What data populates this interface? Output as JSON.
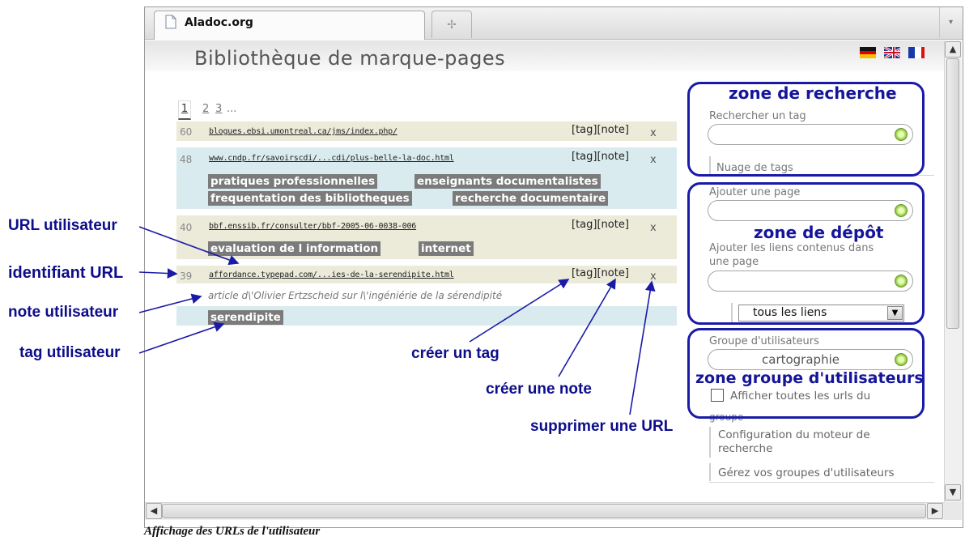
{
  "browser": {
    "tab_title": "Aladoc.org",
    "new_tab_symbol": "✢",
    "tab_menu_symbol": "▾"
  },
  "page": {
    "title": "Bibliothèque de marque-pages",
    "flags": [
      "de-flag-icon",
      "uk-flag-icon",
      "fr-flag-icon"
    ]
  },
  "pager": {
    "current": "1",
    "pages": [
      "2",
      "3"
    ],
    "more": "..."
  },
  "rows": [
    {
      "id": "60",
      "url": "blogues.ebsi.umontreal.ca/jms/index.php/",
      "actions": "[tag][note]",
      "delete": "x",
      "tags": [],
      "note": ""
    },
    {
      "id": "48",
      "url": "www.cndp.fr/savoirscdi/...cdi/plus-belle-la-doc.html",
      "actions": "[tag][note]",
      "delete": "x",
      "tags": [
        "pratiques professionnelles",
        "enseignants documentalistes",
        "frequentation des bibliotheques",
        "recherche documentaire"
      ],
      "note": ""
    },
    {
      "id": "40",
      "url": "bbf.enssib.fr/consulter/bbf-2005-06-0038-006",
      "actions": "[tag][note]",
      "delete": "x",
      "tags": [
        "evaluation de l information",
        "internet"
      ],
      "note": ""
    },
    {
      "id": "39",
      "url": "affordance.typepad.com/...ies-de-la-serendipite.html",
      "actions": "[tag][note]",
      "delete": "x",
      "tags": [
        "serendipite"
      ],
      "note": "article d\\'Olivier Ertzscheid sur l\\'ingéniérie de la sérendipité"
    }
  ],
  "sidebar": {
    "search_label": "Rechercher un tag",
    "tag_cloud": "Nuage de tags",
    "add_page_label": "Ajouter une page",
    "add_links_label_1": "Ajouter les liens contenus dans",
    "add_links_label_2": "une page",
    "links_select": "tous les liens",
    "group_label": "Groupe d'utilisateurs",
    "group_value": "cartographie",
    "show_all_1": "Afficher toutes les urls du",
    "show_all_2": "groupe",
    "config_1": "Configuration du moteur de",
    "config_2": "recherche",
    "manage_groups": "Gérez vos groupes d'utilisateurs"
  },
  "zones": {
    "search": "zone de recherche",
    "deposit": "zone de dépôt",
    "group": "zone groupe d'utilisateurs"
  },
  "annotations": {
    "url_user": "URL utilisateur",
    "url_id": "identifiant URL",
    "user_note": "note utilisateur",
    "user_tag": "tag utilisateur",
    "create_tag": "créer un tag",
    "create_note": "créer une note",
    "delete_url": "supprimer une URL"
  },
  "caption": "Affichage des URLs de l'utilisateur",
  "colors": {
    "annotation_blue": "#1a1aa8",
    "tag_bg": "#7b7b7b",
    "row_beige": "#ecead9",
    "row_cyan": "#d9ebee"
  }
}
